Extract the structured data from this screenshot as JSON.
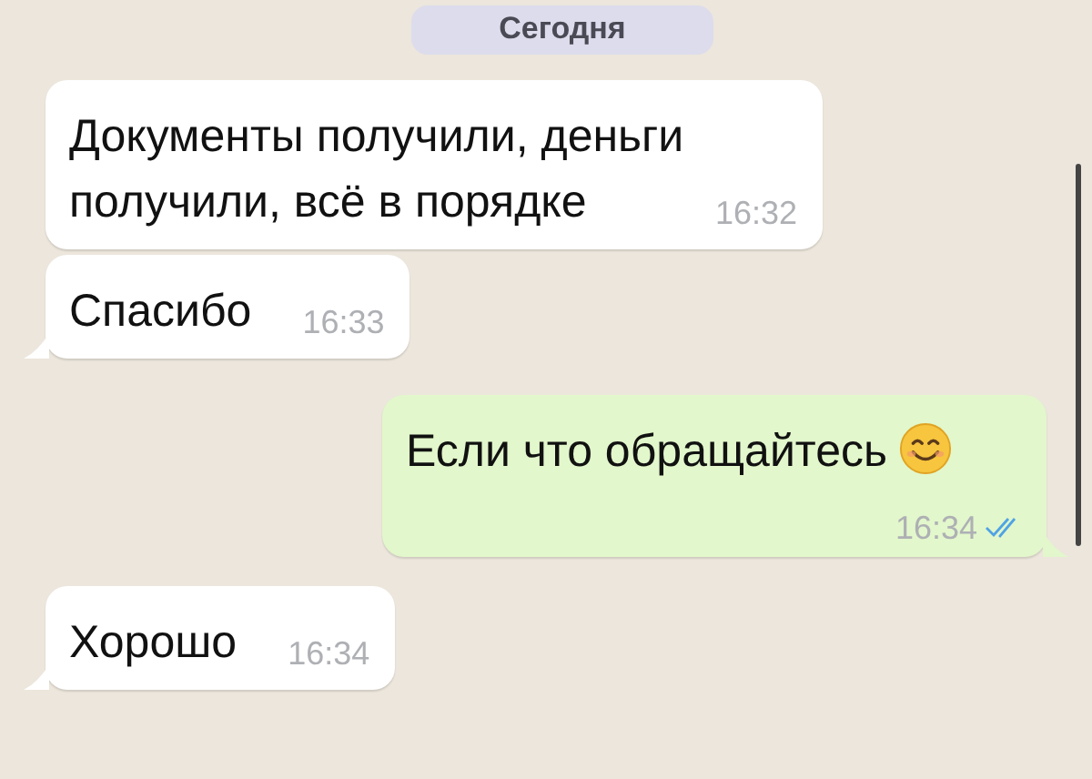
{
  "date_chip": "Сегодня",
  "messages": [
    {
      "kind": "incoming",
      "tail": false,
      "text": "Документы получили, деньги получили, всё в порядке",
      "time": "16:32"
    },
    {
      "kind": "incoming",
      "tail": true,
      "text": "Спасибо",
      "time": "16:33"
    },
    {
      "kind": "outgoing",
      "tail": true,
      "text": "Если что обращайтесь",
      "emoji": true,
      "time": "16:34",
      "read": true
    },
    {
      "kind": "incoming",
      "tail": true,
      "text": "Хорошо",
      "time": "16:34"
    }
  ]
}
